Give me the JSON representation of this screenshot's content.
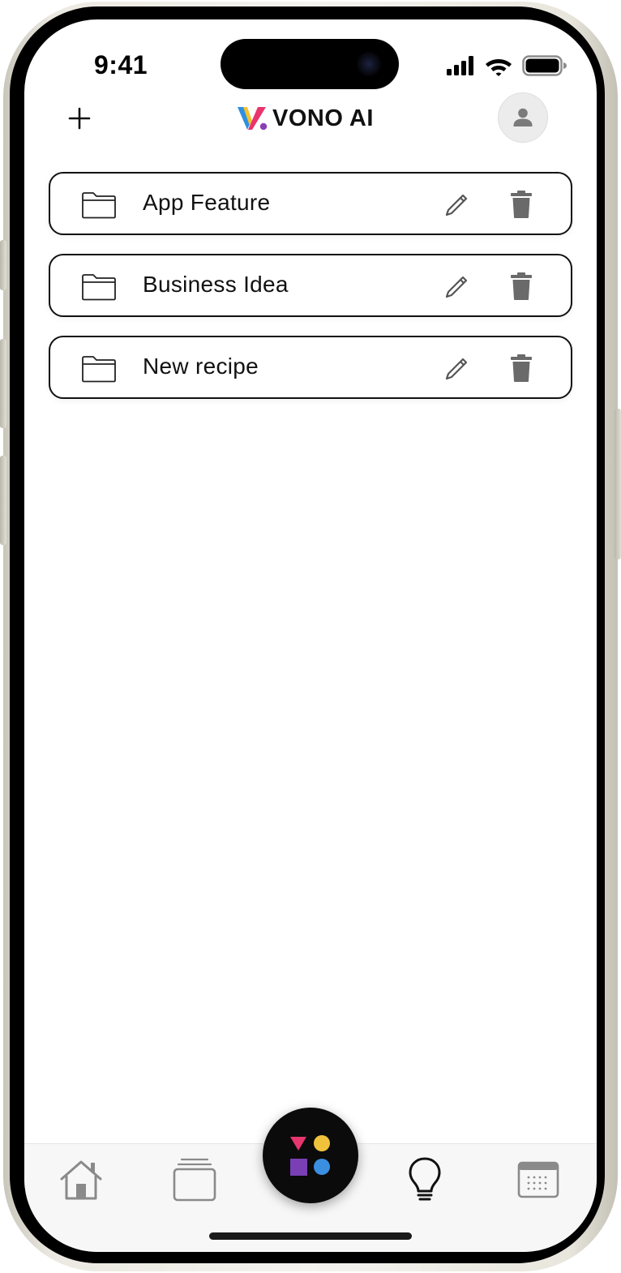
{
  "status_bar": {
    "time": "9:41",
    "icons": [
      "signal-icon",
      "wifi-icon",
      "battery-icon"
    ]
  },
  "header": {
    "add_icon": "plus-icon",
    "logo_text": "VONO AI",
    "avatar_icon": "person-icon"
  },
  "folders": [
    {
      "label": "App Feature",
      "icon": "folder-icon",
      "actions": [
        "pencil-icon",
        "trash-icon"
      ]
    },
    {
      "label": "Business Idea",
      "icon": "folder-icon",
      "actions": [
        "pencil-icon",
        "trash-icon"
      ]
    },
    {
      "label": "New recipe",
      "icon": "folder-icon",
      "actions": [
        "pencil-icon",
        "trash-icon"
      ]
    }
  ],
  "bottom_nav": {
    "items": [
      "home-icon",
      "cards-icon",
      "shapes-icon",
      "lightbulb-icon",
      "calendar-icon"
    ],
    "active": "lightbulb-icon"
  },
  "colors": {
    "logo_blue": "#2f8fe0",
    "logo_yellow": "#f2c230",
    "logo_pink": "#e9346c",
    "logo_purple": "#8a3fb3",
    "fab_triangle": "#e6366e",
    "fab_circle_yellow": "#f0c23b",
    "fab_square": "#7a3fb5",
    "fab_circle_blue": "#3a8fe0"
  }
}
